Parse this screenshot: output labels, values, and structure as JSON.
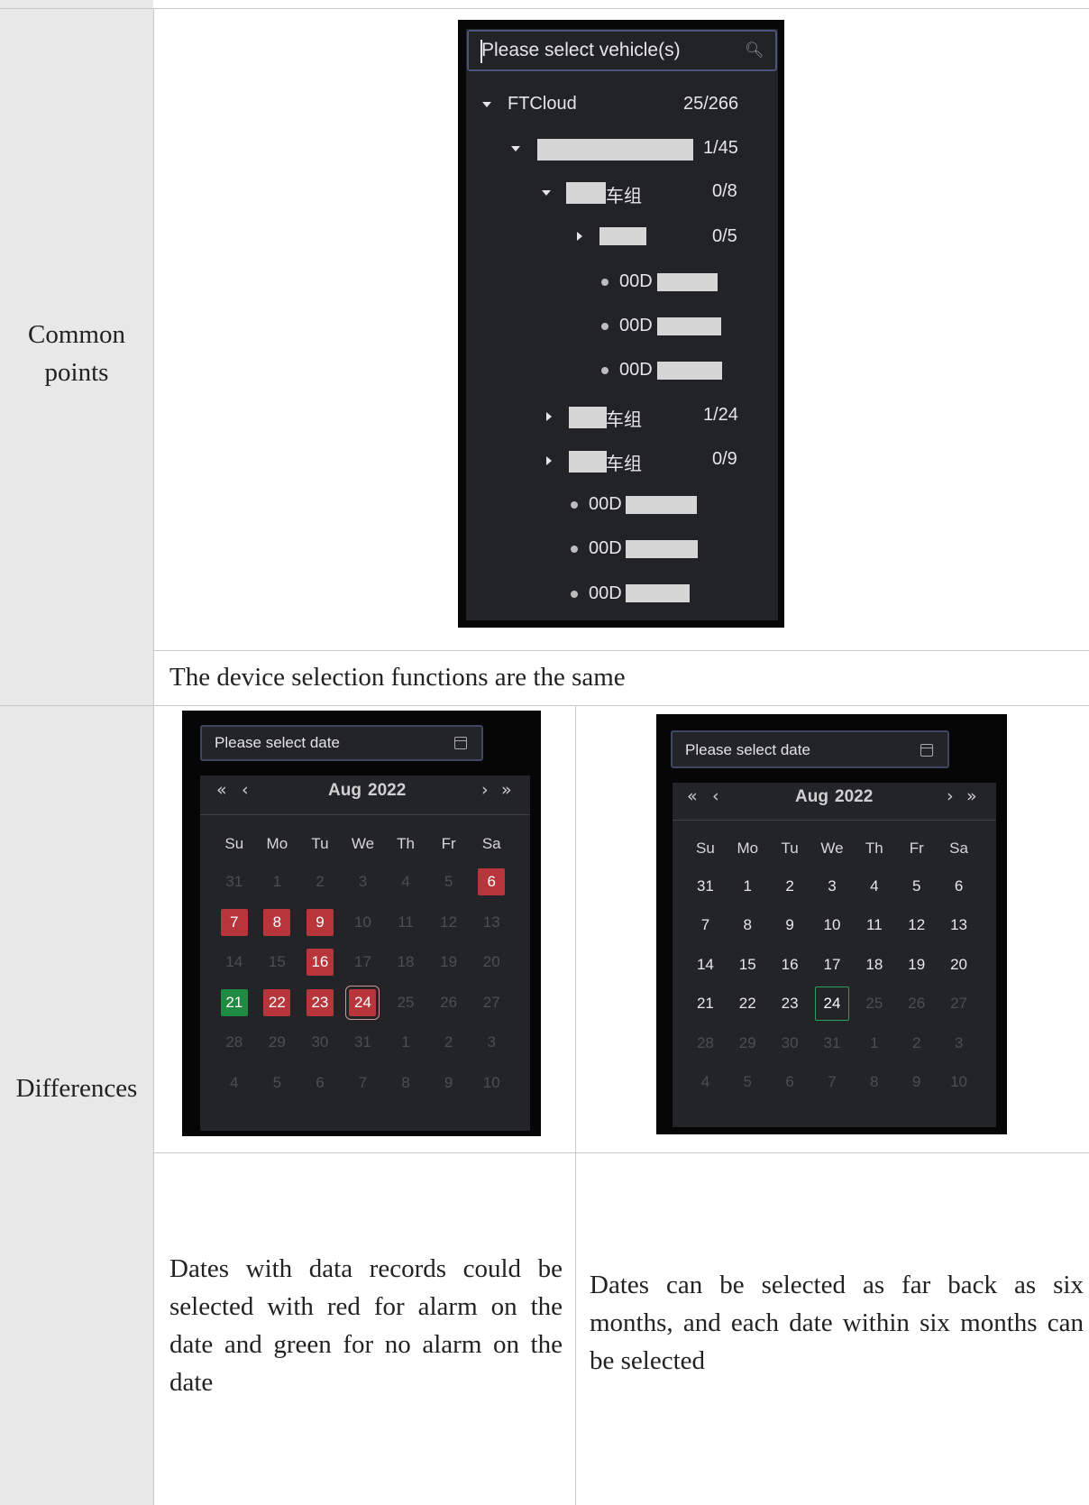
{
  "table": {
    "row1_label": "Common points",
    "row1_note": "The device selection functions are the same",
    "row2_label": "Differences",
    "row2_note_left": "Dates with data records could be selected with red for alarm on the date and green for no alarm on the date",
    "row2_note_right": "Dates can be selected as far back as six months, and each date within six months can be selected"
  },
  "vehicle_selector": {
    "placeholder": "Please select vehicle(s)",
    "search_icon": "search-icon",
    "nodes": [
      {
        "label": "FTCloud",
        "count": "25/266"
      },
      {
        "label": "",
        "count": "1/45"
      },
      {
        "label": "车组",
        "count": "0/8"
      },
      {
        "label": "",
        "count": "0/5"
      },
      {
        "label": "00D",
        "count": ""
      },
      {
        "label": "00D",
        "count": ""
      },
      {
        "label": "00D",
        "count": ""
      },
      {
        "label": "车组",
        "count": "1/24"
      },
      {
        "label": "车组",
        "count": "0/9"
      },
      {
        "label": "00D",
        "count": ""
      },
      {
        "label": "00D",
        "count": ""
      },
      {
        "label": "00D",
        "count": ""
      }
    ]
  },
  "calendars": {
    "placeholder": "Please select date",
    "month": "Aug",
    "year": "2022",
    "nav_prev_year": "«",
    "nav_prev_month": "‹",
    "nav_next_month": "›",
    "nav_next_year": "»",
    "weekdays": [
      "Su",
      "Mo",
      "Tu",
      "We",
      "Th",
      "Fr",
      "Sa"
    ],
    "days": [
      "31",
      "1",
      "2",
      "3",
      "4",
      "5",
      "6",
      "7",
      "8",
      "9",
      "10",
      "11",
      "12",
      "13",
      "14",
      "15",
      "16",
      "17",
      "18",
      "19",
      "20",
      "21",
      "22",
      "23",
      "24",
      "25",
      "26",
      "27",
      "28",
      "29",
      "30",
      "31",
      "1",
      "2",
      "3",
      "4",
      "5",
      "6",
      "7",
      "8",
      "9",
      "10"
    ],
    "left_states": [
      "m",
      "m",
      "m",
      "m",
      "m",
      "m",
      "red",
      "red",
      "red",
      "red",
      "m",
      "m",
      "m",
      "m",
      "m",
      "m",
      "red",
      "m",
      "m",
      "m",
      "m",
      "green",
      "red",
      "red",
      "today-red",
      "m",
      "m",
      "m",
      "m",
      "m",
      "m",
      "m",
      "m",
      "m",
      "m",
      "m",
      "m",
      "m",
      "m",
      "m",
      "m",
      "m"
    ],
    "right_states": [
      "b",
      "b",
      "b",
      "b",
      "b",
      "b",
      "b",
      "b",
      "b",
      "b",
      "b",
      "b",
      "b",
      "b",
      "b",
      "b",
      "b",
      "b",
      "b",
      "b",
      "b",
      "b",
      "b",
      "b",
      "today-green",
      "m",
      "m",
      "m",
      "m",
      "m",
      "m",
      "m",
      "m",
      "m",
      "m",
      "m",
      "m",
      "m",
      "m",
      "m",
      "m",
      "m"
    ],
    "colors": {
      "alarm": "#b8353b",
      "no_alarm": "#1f8a42"
    }
  }
}
